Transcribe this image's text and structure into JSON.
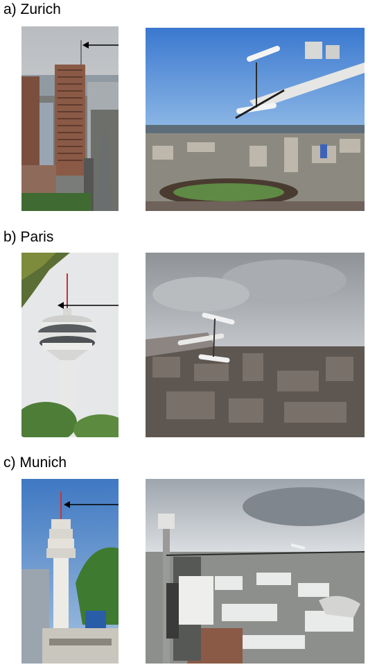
{
  "panels": [
    {
      "label": "a) Zurich"
    },
    {
      "label": "b) Paris"
    },
    {
      "label": "c) Munich"
    }
  ],
  "colors": {
    "sky_clear": "#3f7fd0",
    "sky_overcast": "#9c9fa4",
    "tower_white": "#e8e8e6",
    "building_brown": "#8a5a46",
    "foliage": "#4e7d38",
    "arrow": "#000000"
  }
}
